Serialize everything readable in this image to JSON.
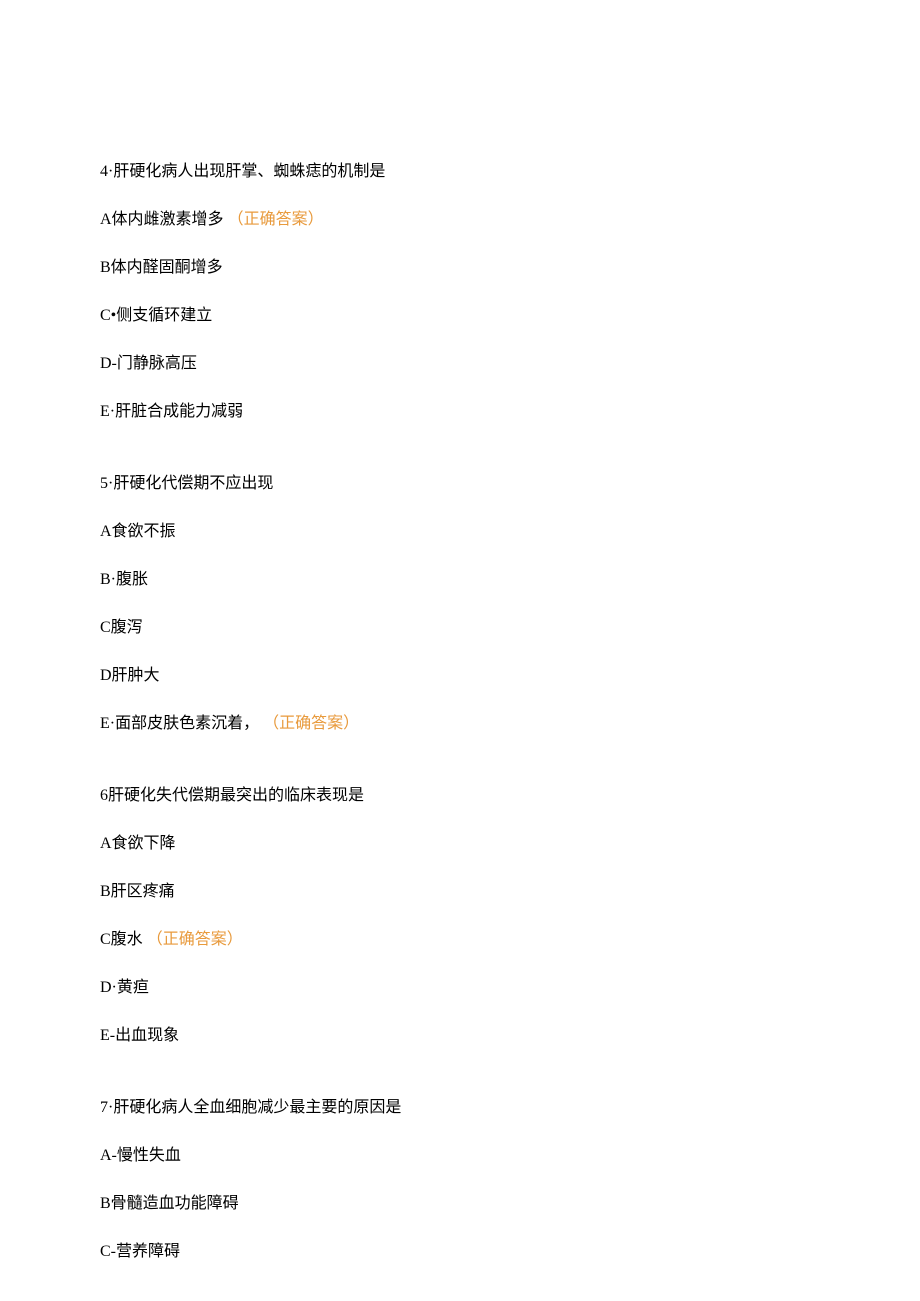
{
  "questions": [
    {
      "title": "4·肝硬化病人出现肝掌、蜘蛛痣的机制是",
      "options": [
        {
          "text": "A体内雌激素增多",
          "correct": "（正确答案）"
        },
        {
          "text": "B体内醛固酮增多",
          "correct": ""
        },
        {
          "text": "C•侧支循环建立",
          "correct": ""
        },
        {
          "text": "D-门静脉高压",
          "correct": ""
        },
        {
          "text": "E·肝脏合成能力减弱",
          "correct": ""
        }
      ]
    },
    {
      "title": "5·肝硬化代偿期不应出现",
      "options": [
        {
          "text": "A食欲不振",
          "correct": ""
        },
        {
          "text": "B·腹胀",
          "correct": ""
        },
        {
          "text": "C腹泻",
          "correct": ""
        },
        {
          "text": "D肝肿大",
          "correct": ""
        },
        {
          "text": "E·面部皮肤色素沉着，",
          "correct": "（正确答案）"
        }
      ]
    },
    {
      "title": "6肝硬化失代偿期最突出的临床表现是",
      "options": [
        {
          "text": "A食欲下降",
          "correct": ""
        },
        {
          "text": "B肝区疼痛",
          "correct": ""
        },
        {
          "text": "C腹水",
          "correct": "（正确答案）"
        },
        {
          "text": "D·黄疸",
          "correct": ""
        },
        {
          "text": "E-出血现象",
          "correct": ""
        }
      ]
    },
    {
      "title": "7·肝硬化病人全血细胞减少最主要的原因是",
      "options": [
        {
          "text": "A-慢性失血",
          "correct": ""
        },
        {
          "text": "B骨髓造血功能障碍",
          "correct": ""
        },
        {
          "text": "C-营养障碍",
          "correct": ""
        }
      ]
    }
  ]
}
